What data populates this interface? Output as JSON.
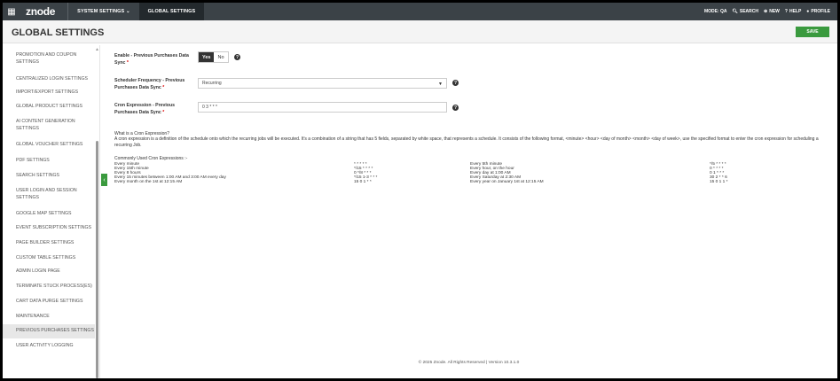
{
  "topnav": {
    "logo": "znode",
    "menu_icon": "grid-icon",
    "items": [
      "SYSTEM SETTINGS ⌄",
      "GLOBAL SETTINGS"
    ],
    "mode": "MODE: QA",
    "search": "SEARCH",
    "new": "NEW",
    "help": "HELP",
    "profile": "PROFILE"
  },
  "header": {
    "title": "GLOBAL SETTINGS",
    "save": "SAVE"
  },
  "sidebar": {
    "items": [
      "PROMOTION AND COUPON SETTINGS",
      "CENTRALIZED LOGIN SETTINGS",
      "IMPORT/EXPORT SETTINGS",
      "GLOBAL PRODUCT SETTINGS",
      "AI CONTENT GENERATION SETTINGS",
      "GLOBAL VOUCHER SETTINGS",
      "PDF SETTINGS",
      "SEARCH SETTINGS",
      "USER LOGIN AND SESSION SETTINGS",
      "GOOGLE MAP SETTINGS",
      "EVENT SUBSCRIPTION SETTINGS",
      "PAGE BUILDER SETTINGS",
      "CUSTOM TABLE SETTINGS",
      "ADMIN LOGIN PAGE",
      "TERMINATE STUCK PROCESS(ES)",
      "CART DATA PURGE SETTINGS",
      "MAINTENANCE",
      "PREVIOUS PURCHASES SETTINGS",
      "USER ACTIVITY LOGGING"
    ],
    "active_index": 17
  },
  "form": {
    "enable_label": "Enable - Previous Purchases Data Sync",
    "yes": "Yes",
    "no": "No",
    "freq_label": "Scheduler Frequency - Previous Purchases Data Sync",
    "freq_value": "Recurring",
    "cron_label": "Cron Expression - Previous Purchases Data Sync",
    "cron_value": "0 3 * * *",
    "required_mark": "*"
  },
  "info": {
    "question": "What is a Cron Expression?",
    "text": "A cron expression is a definition of the schedule onto which the recurring jobs will be executed. It's a combination of a string that has 5 fields, separated by white space, that represents a schedule. It consists of the following format, <minute> <hour> <day of month> <month> <day of week>, use the specified format to enter the cron expression for scheduling a recurring Job.",
    "common_heading": "Commonly Used Cron Expressions :-",
    "left": [
      {
        "desc": "Every minute",
        "expr": "* * * * *"
      },
      {
        "desc": "Every 15th minute",
        "expr": "*/15 * * * *"
      },
      {
        "desc": "Every 8 hours",
        "expr": "0 */8 * * *"
      },
      {
        "desc": "Every 15 minutes between 1:00 AM and 3:00 AM every day",
        "expr": "*/15 1-3 * * *"
      },
      {
        "desc": "Every month on the 1st at 12:15 AM",
        "expr": "15 0 1 * *"
      }
    ],
    "right": [
      {
        "desc": "Every 5th minute",
        "expr": "*/5 * * * *"
      },
      {
        "desc": "Every hour, on the hour",
        "expr": "0 * * * *"
      },
      {
        "desc": "Every day at 1:00 AM",
        "expr": "0 1 * * *"
      },
      {
        "desc": "Every Saturday at 2:30 AM",
        "expr": "30 2 * * 6"
      },
      {
        "desc": "Every year on January 1st at 12:15 AM",
        "expr": "15 0 1 1 *"
      }
    ]
  },
  "footer": "© 2025 Znode. All Rights Reserved | Version 10.3.1.0"
}
